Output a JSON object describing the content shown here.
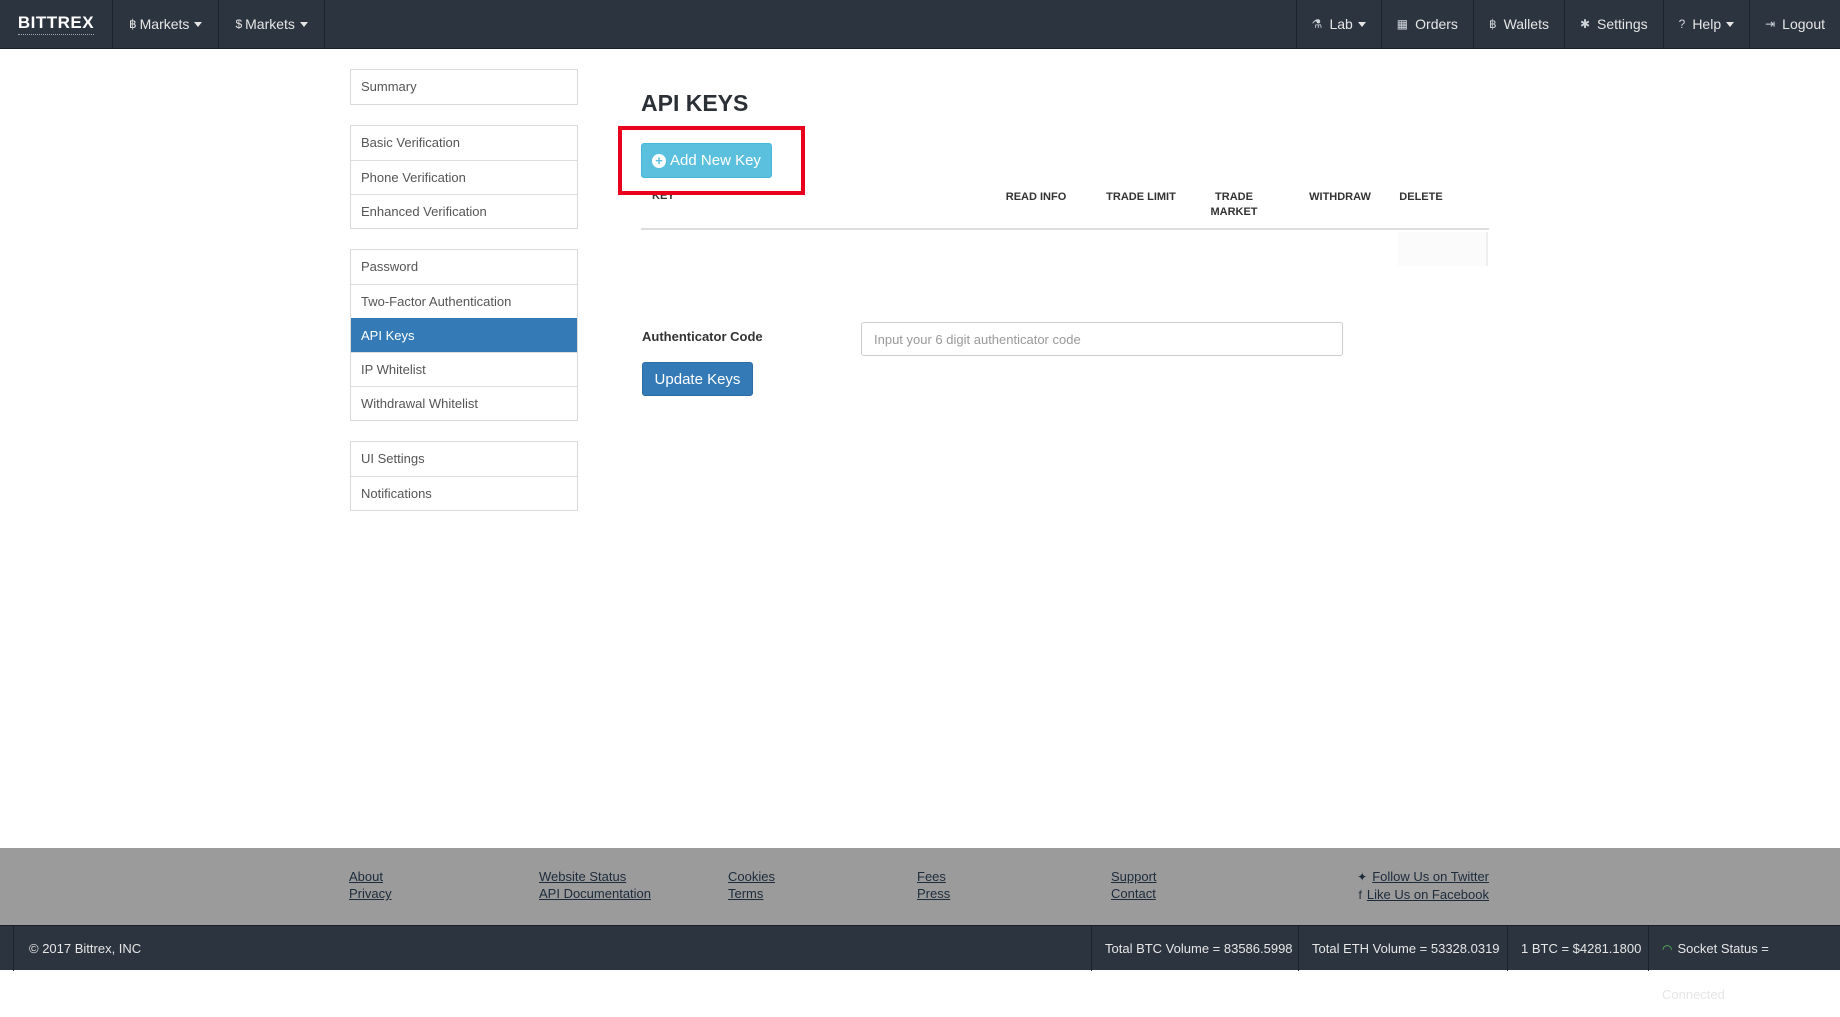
{
  "navbar": {
    "brand": "BITTREX",
    "left": [
      {
        "symbol": "฿",
        "label": "Markets"
      },
      {
        "symbol": "$",
        "label": "Markets"
      }
    ],
    "right": [
      {
        "icon": "⚗",
        "label": "Lab",
        "icon_name": "flask-icon",
        "dropdown": true
      },
      {
        "icon": "▦",
        "label": "Orders",
        "icon_name": "calendar-icon"
      },
      {
        "icon": "฿",
        "label": "Wallets",
        "icon_name": "bitcoin-icon"
      },
      {
        "icon": "✱",
        "label": "Settings",
        "icon_name": "gear-icon"
      },
      {
        "icon": "?",
        "label": "Help",
        "icon_name": "question-circle-icon",
        "dropdown": true
      },
      {
        "icon": "⇥",
        "label": "Logout",
        "icon_name": "logout-icon"
      }
    ]
  },
  "sidebar": {
    "groups": [
      [
        "Summary"
      ],
      [
        "Basic Verification",
        "Phone Verification",
        "Enhanced Verification"
      ],
      [
        "Password",
        "Two-Factor Authentication",
        "API Keys",
        "IP Whitelist",
        "Withdrawal Whitelist"
      ],
      [
        "UI Settings",
        "Notifications"
      ]
    ],
    "active": "API Keys"
  },
  "main": {
    "title": "API KEYS",
    "add_key_label": "Add New Key",
    "table_headers": {
      "key": "KEY",
      "read_info": "READ INFO",
      "trade_limit": "TRADE LIMIT",
      "trade_market_1": "TRADE",
      "trade_market_2": "MARKET",
      "withdraw": "WITHDRAW",
      "delete": "DELETE"
    },
    "auth_label": "Authenticator Code",
    "auth_placeholder": "Input your 6 digit authenticator code",
    "auth_value": "",
    "update_label": "Update Keys"
  },
  "footer": {
    "columns": [
      [
        "About",
        "Privacy"
      ],
      [
        "Website Status",
        "API Documentation"
      ],
      [
        "Cookies",
        "Terms"
      ],
      [
        "Fees",
        "Press"
      ],
      [
        "Support",
        "Contact"
      ]
    ],
    "social": [
      {
        "icon": "🐦",
        "label": "Follow Us on Twitter",
        "icon_name": "twitter-icon"
      },
      {
        "icon": "f",
        "label": "Like Us on Facebook",
        "icon_name": "facebook-icon"
      }
    ]
  },
  "status_bar": {
    "copyright": "© 2017 Bittrex, INC",
    "btc_volume": "Total BTC Volume = 83586.5998",
    "eth_volume": "Total ETH Volume = 53328.0319",
    "btc_price": "1 BTC = $4281.1800",
    "socket_status": "Socket Status = Connected"
  },
  "colors": {
    "navbar_bg": "#2c3440",
    "active_blue": "#337ab7",
    "info_button": "#5bc0de",
    "highlight_red": "#e8001c",
    "footer_gray": "#9b9b9b"
  }
}
